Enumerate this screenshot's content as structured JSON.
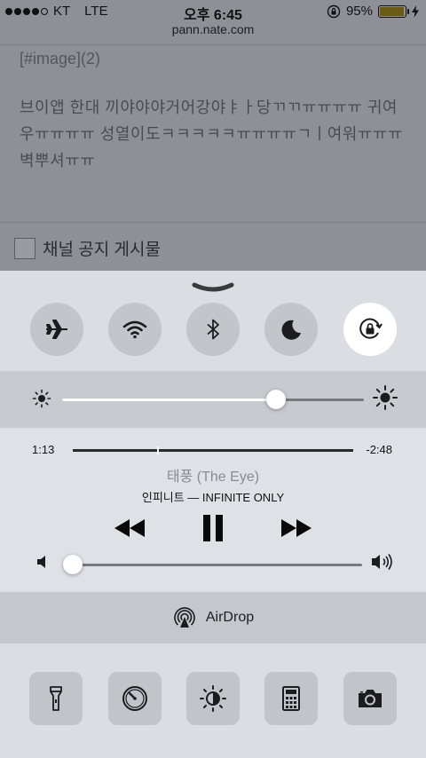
{
  "status_bar": {
    "carrier": "KT",
    "network": "LTE",
    "time": "오후 6:45",
    "battery": "95%",
    "battery_level": 0.95
  },
  "browser": {
    "url": "pann.nate.com"
  },
  "post": {
    "image_tag": "[#image](2)",
    "body": "브이앱 한대 끼야야야거어강야ㅑㅏ당ㄲㄲㅠㅠㅠㅠ 귀여우ㅠㅠㅠㅠ 성열이도ㅋㅋㅋㅋㅋㅠㅠㅠㅠㄱㅣ여워ㅠㅠㅠ벽뿌셔ㅠㅠ",
    "notice_label": "채널 공지 게시물"
  },
  "control_center": {
    "toggles": [
      {
        "name": "airplane-mode",
        "icon": "airplane-icon",
        "active": false
      },
      {
        "name": "wifi",
        "icon": "wifi-icon",
        "active": false
      },
      {
        "name": "bluetooth",
        "icon": "bluetooth-icon",
        "active": false
      },
      {
        "name": "do-not-disturb",
        "icon": "moon-icon",
        "active": false
      },
      {
        "name": "rotation-lock",
        "icon": "rotation-lock-icon",
        "active": true
      }
    ],
    "brightness": 0.71,
    "media": {
      "elapsed": "1:13",
      "remaining": "-2:48",
      "progress": 0.3,
      "title": "태풍 (The Eye)",
      "artist_album": "인피니트 — INFINITE ONLY",
      "volume": 0.0
    },
    "airdrop_label": "AirDrop",
    "shortcuts": [
      {
        "name": "flashlight",
        "icon": "flashlight-icon"
      },
      {
        "name": "timer",
        "icon": "timer-icon"
      },
      {
        "name": "night-shift",
        "icon": "night-shift-icon"
      },
      {
        "name": "calculator",
        "icon": "calculator-icon"
      },
      {
        "name": "camera",
        "icon": "camera-icon"
      }
    ]
  },
  "colors": {
    "panel": "#dcdde2",
    "toggle_inactive": "#c4c5cb",
    "toggle_active": "#ffffff",
    "battery_fill": "#6b5a14"
  }
}
